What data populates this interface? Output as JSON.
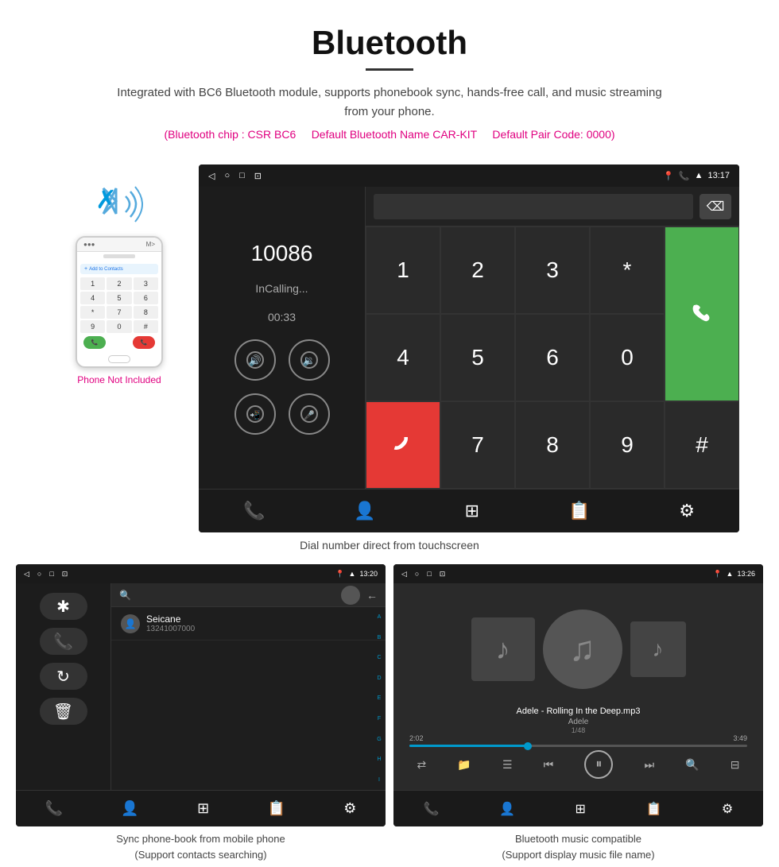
{
  "header": {
    "title": "Bluetooth",
    "subtitle": "Integrated with BC6 Bluetooth module, supports phonebook sync, hands-free call, and music streaming from your phone.",
    "spec_line": "(Bluetooth chip : CSR BC6    Default Bluetooth Name CAR-KIT    Default Pair Code: 0000)",
    "spec_chip": "Bluetooth chip : CSR BC6",
    "spec_name": "Default Bluetooth Name CAR-KIT",
    "spec_code": "Default Pair Code: 0000"
  },
  "main_screen": {
    "statusbar": {
      "nav_back": "◁",
      "nav_home": "○",
      "nav_recent": "□",
      "nav_app": "⊡",
      "time": "13:17",
      "icons": [
        "📍",
        "📞",
        "📶"
      ]
    },
    "dial": {
      "number": "10086",
      "status": "InCalling...",
      "timer": "00:33",
      "keys": [
        "1",
        "2",
        "3",
        "*",
        "4",
        "5",
        "6",
        "0",
        "7",
        "8",
        "9",
        "#"
      ],
      "delete_char": "⌫",
      "call_icon": "📞",
      "end_icon": "📞"
    },
    "bottom_icons": [
      "📞",
      "👤",
      "⊞",
      "📋",
      "⚙"
    ]
  },
  "caption_main": "Dial number direct from touchscreen",
  "phone_side": {
    "not_included": "Phone Not Included"
  },
  "bottom_left": {
    "statusbar_time": "13:20",
    "contact_name": "Seicane",
    "contact_number": "13241007000",
    "alphabet": [
      "A",
      "B",
      "C",
      "D",
      "E",
      "F",
      "G",
      "H",
      "I"
    ],
    "caption": "Sync phone-book from mobile phone\n(Support contacts searching)"
  },
  "bottom_right": {
    "statusbar_time": "13:26",
    "song_title": "Adele - Rolling In the Deep.mp3",
    "artist": "Adele",
    "track_info": "1/48",
    "time_current": "2:02",
    "time_total": "3:49",
    "caption": "Bluetooth music compatible\n(Support display music file name)"
  }
}
